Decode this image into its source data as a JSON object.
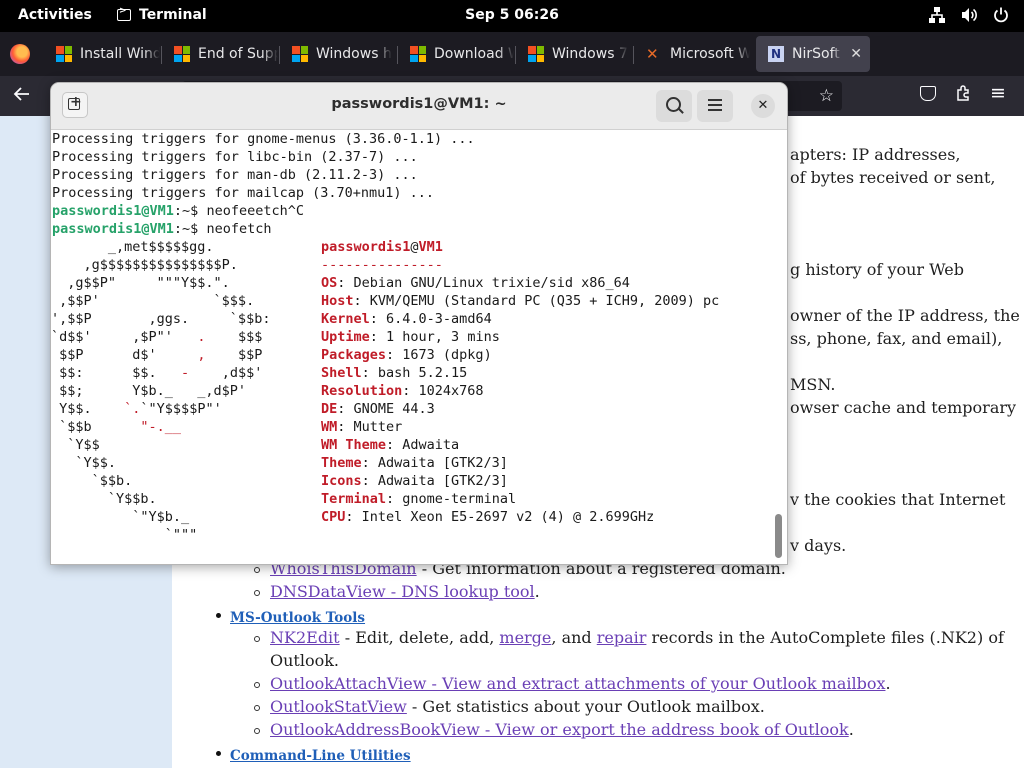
{
  "topbar": {
    "activities": "Activities",
    "app_name": "Terminal",
    "clock": "Sep 5  06:26",
    "icons": [
      "network-icon",
      "volume-icon",
      "power-icon"
    ]
  },
  "browser": {
    "tabs": [
      {
        "label": "Install Wind",
        "favicon": "windows-icon",
        "active": false
      },
      {
        "label": "End of Supp",
        "favicon": "windows-icon",
        "active": false
      },
      {
        "label": "Windows h",
        "favicon": "windows-icon",
        "active": false
      },
      {
        "label": "Download W",
        "favicon": "windows-icon",
        "active": false
      },
      {
        "label": "Windows 7",
        "favicon": "windows-icon",
        "active": false
      },
      {
        "label": "Microsoft W",
        "favicon": "microsoft-icon",
        "active": false
      },
      {
        "label": "NirSoft - ",
        "favicon": "nirsoft-icon",
        "active": true
      }
    ],
    "new_tab": "+",
    "close": "✕"
  },
  "webpage": {
    "fragments": {
      "f1": "apters: IP addresses,",
      "f2": "of bytes received or sent,",
      "f3": "g history of your Web",
      "f4": "owner of the IP address, the",
      "f5": "ss, phone, fax, and email),",
      "f6": "MSN.",
      "f7": "owser cache and temporary",
      "f8": "v the cookies that Internet",
      "f9": "v days."
    },
    "items": [
      {
        "link": "WhoisThisDomain",
        "text": " - Get information about a registered domain."
      },
      {
        "link": "DNSDataView - DNS lookup tool",
        "text": "."
      }
    ],
    "section_outlook": "MS-Outlook Tools",
    "outlook_items": {
      "nk2_link": "NK2Edit",
      "nk2_text1": " - Edit, delete, add, ",
      "merge": "merge",
      "nk2_text2": ", and ",
      "repair": "repair",
      "nk2_text3": " records in the AutoComplete files (.NK2) of",
      "nk2_line2": "Outlook.",
      "attach_link": "OutlookAttachView - View and extract attachments of your Outlook mailbox",
      "attach_end": ".",
      "stat_link": "OutlookStatView",
      "stat_text": " - Get statistics about your Outlook mailbox.",
      "addr_link": "OutlookAddressBookView - View or export the address book of Outlook",
      "addr_end": "."
    },
    "section_cmd": "Command-Line Utilities"
  },
  "terminal": {
    "title": "passwordis1@VM1: ~",
    "lines": [
      "Processing triggers for gnome-menus (3.36.0-1.1) ...",
      "Processing triggers for libc-bin (2.37-7) ...",
      "Processing triggers for man-db (2.11.2-3) ...",
      "Processing triggers for mailcap (3.70+nmu1) ..."
    ],
    "prompt": "passwordis1@VM1",
    "prompt_suffix": ":~$ ",
    "cmd1": "neofeeetch^C",
    "cmd2": "neofetch",
    "user": "passwordis1",
    "at": "@",
    "host": "VM1",
    "separator": "---------------",
    "info": [
      {
        "key": "OS",
        "value": ": Debian GNU/Linux trixie/sid x86_64"
      },
      {
        "key": "Host",
        "value": ": KVM/QEMU (Standard PC (Q35 + ICH9, 2009) pc"
      },
      {
        "key": "Kernel",
        "value": ": 6.4.0-3-amd64"
      },
      {
        "key": "Uptime",
        "value": ": 1 hour, 3 mins"
      },
      {
        "key": "Packages",
        "value": ": 1673 (dpkg)"
      },
      {
        "key": "Shell",
        "value": ": bash 5.2.15"
      },
      {
        "key": "Resolution",
        "value": ": 1024x768"
      },
      {
        "key": "DE",
        "value": ": GNOME 44.3"
      },
      {
        "key": "WM",
        "value": ": Mutter"
      },
      {
        "key": "WM Theme",
        "value": ": Adwaita"
      },
      {
        "key": "Theme",
        "value": ": Adwaita [GTK2/3]"
      },
      {
        "key": "Icons",
        "value": ": Adwaita [GTK2/3]"
      },
      {
        "key": "Terminal",
        "value": ": gnome-terminal"
      },
      {
        "key": "CPU",
        "value": ": Intel Xeon E5-2697 v2 (4) @ 2.699GHz"
      }
    ]
  }
}
